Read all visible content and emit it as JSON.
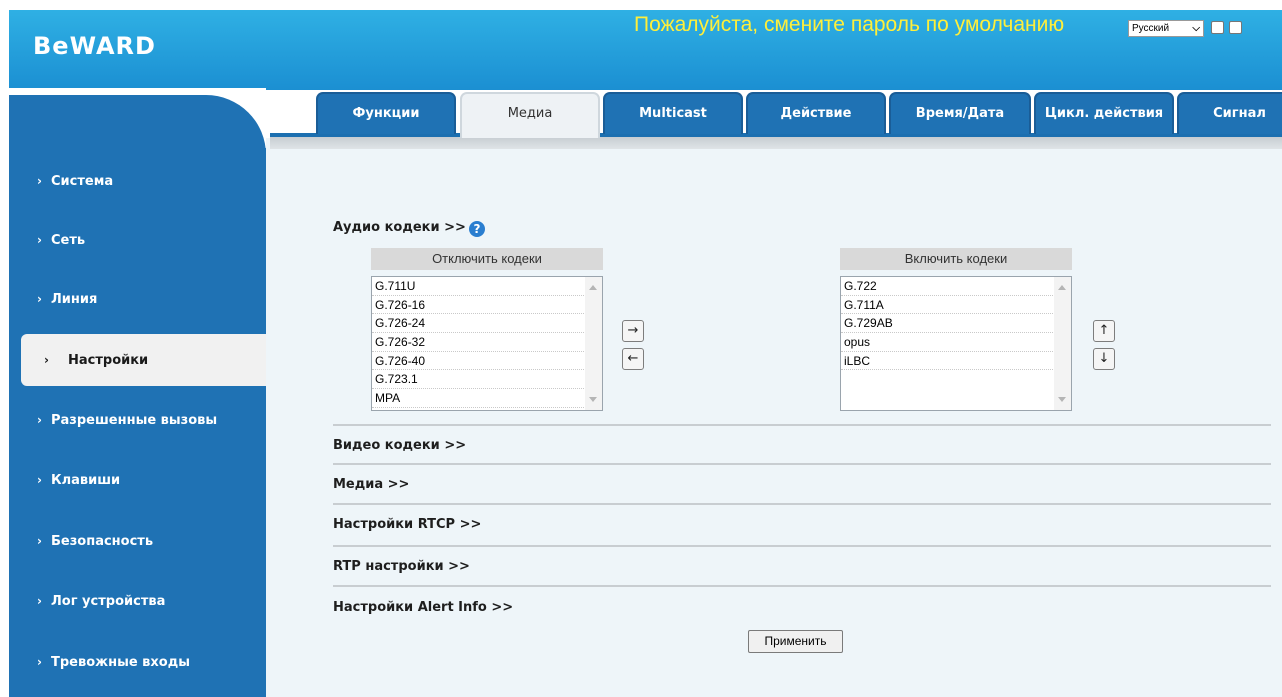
{
  "header": {
    "logo": "BeWARD",
    "warning": "Пожалуйста, смените пароль по умолчанию",
    "language": "Русский"
  },
  "sidebar": {
    "items": [
      {
        "label": "Система"
      },
      {
        "label": "Сеть"
      },
      {
        "label": "Линия"
      },
      {
        "label": "Настройки",
        "active": true
      },
      {
        "label": "Разрешенные вызовы"
      },
      {
        "label": "Клавиши"
      },
      {
        "label": "Безопасность"
      },
      {
        "label": "Лог устройства"
      },
      {
        "label": "Тревожные входы"
      }
    ]
  },
  "tabs": [
    {
      "label": "Функции"
    },
    {
      "label": "Медиа",
      "active": true
    },
    {
      "label": "Multicast"
    },
    {
      "label": "Действие"
    },
    {
      "label": "Время/Дата"
    },
    {
      "label": "Цикл. действия"
    },
    {
      "label": "Сигнал"
    }
  ],
  "audio": {
    "title": "Аудио кодеки >>",
    "disabled_header": "Отключить кодеки",
    "enabled_header": "Включить кодеки",
    "disabled_codecs": [
      "G.711U",
      "G.726-16",
      "G.726-24",
      "G.726-32",
      "G.726-40",
      "G.723.1",
      "MPA"
    ],
    "enabled_codecs": [
      "G.722",
      "G.711A",
      "G.729AB",
      "opus",
      "iLBC"
    ],
    "move_right": "→",
    "move_left": "←",
    "move_up": "↑",
    "move_down": "↓"
  },
  "sections": {
    "video": "Видео кодеки >>",
    "media": "Медиа >>",
    "rtcp": "Настройки RTCP >>",
    "rtp": "RTP настройки >>",
    "alert": "Настройки Alert Info >>"
  },
  "apply_label": "Применить",
  "colors": {
    "header_blue": "#1b8fd2",
    "sidebar_blue": "#1f72b4",
    "warning_yellow": "#ffef3a"
  }
}
